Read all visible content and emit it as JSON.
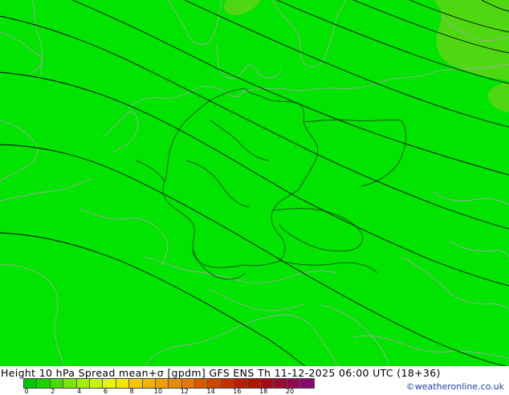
{
  "title": "Height 10 hPa Spread mean+σ [gpdm] GFS ENS   Th 11-12-2025 06:00 UTC (18+36)",
  "credit": "©weatheronline.co.uk",
  "colorbar": {
    "ticks": [
      "0",
      "2",
      "4",
      "6",
      "8",
      "10",
      "12",
      "14",
      "16",
      "18",
      "20"
    ],
    "colors": [
      "#00c800",
      "#1ed200",
      "#46dc00",
      "#78e600",
      "#a0ef00",
      "#c8f500",
      "#e6f500",
      "#f5e600",
      "#f5c800",
      "#f0b400",
      "#eba000",
      "#e68c00",
      "#e17800",
      "#d75a00",
      "#cd4600",
      "#c33200",
      "#b91e00",
      "#af1400",
      "#a50a14",
      "#9b0a32",
      "#910a50",
      "#870a6e"
    ]
  },
  "map": {
    "fill_main": "#00e400",
    "fill_light": "#4fd812",
    "contour_color": "#000000",
    "border_color": "#9fa8a0",
    "country_border_color": "#1a3a1a"
  }
}
